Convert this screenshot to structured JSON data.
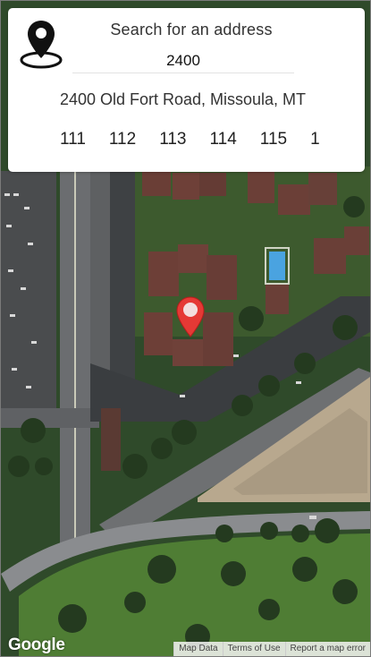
{
  "search": {
    "title": "Search for an address",
    "input_value": "2400"
  },
  "result": {
    "address": "2400 Old Fort Road, Missoula, MT"
  },
  "suggestions": [
    "111",
    "112",
    "113",
    "114",
    "115",
    "1"
  ],
  "map": {
    "logo_text": "Google",
    "marker_icon": "map-marker-icon",
    "marker_color": "#e53935"
  },
  "footer": {
    "map_data": "Map Data",
    "terms": "Terms of Use",
    "report": "Report a map error"
  }
}
